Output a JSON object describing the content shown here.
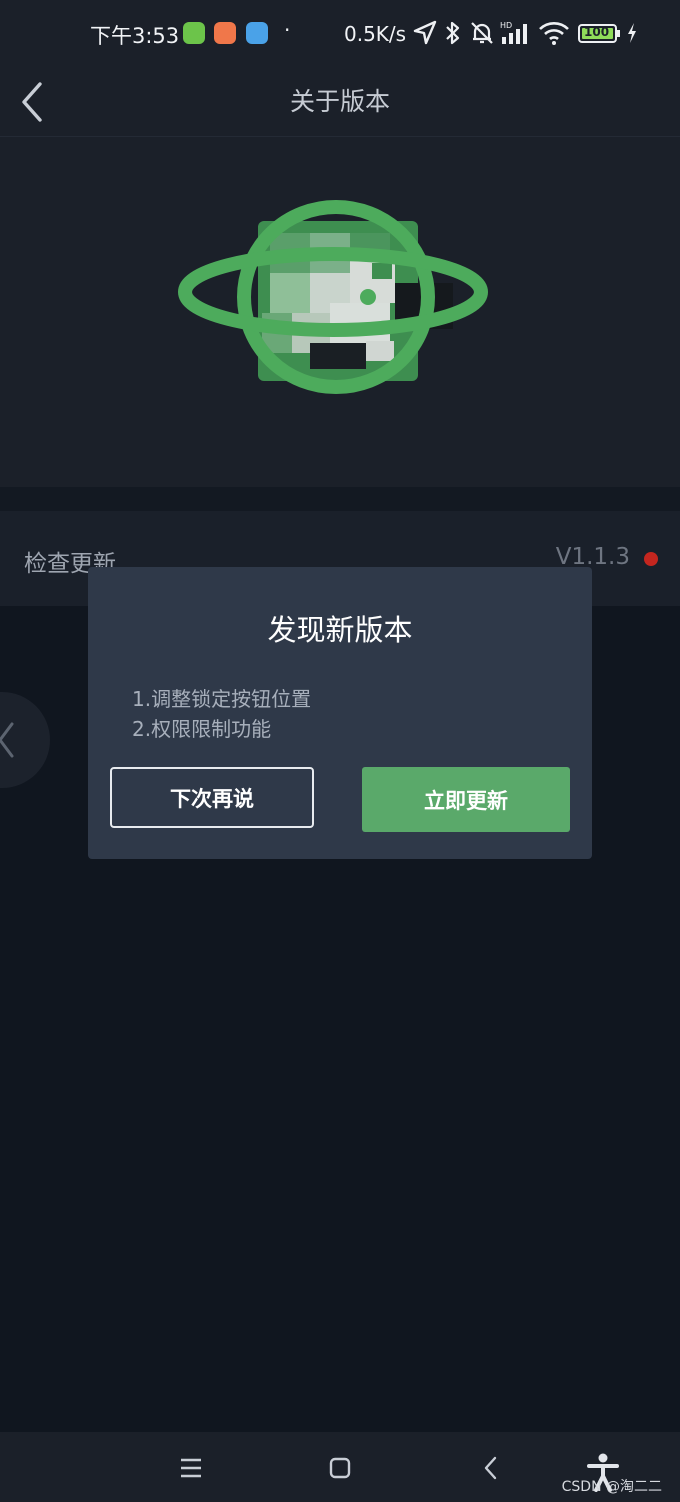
{
  "status_bar": {
    "time": "下午3:53",
    "dot": "·",
    "net_speed": "0.5K/s",
    "battery": "100",
    "icons": [
      "app-icon-green",
      "app-icon-orange",
      "app-icon-weather",
      "location-icon",
      "bluetooth-icon",
      "mute-icon",
      "signal-icon",
      "wifi-icon",
      "battery-icon",
      "charging-icon"
    ]
  },
  "nav": {
    "title": "关于版本",
    "back_icon": "chevron-left-icon"
  },
  "settings": {
    "check_update_label": "检查更新",
    "version": "V1.1.3"
  },
  "dialog": {
    "title": "发现新版本",
    "notes": [
      "1.调整锁定按钮位置",
      "2.权限限制功能"
    ],
    "later_label": "下次再说",
    "update_label": "立即更新"
  },
  "system_nav": {
    "icons": [
      "menu-icon",
      "home-icon",
      "back-icon",
      "accessibility-icon"
    ]
  },
  "watermark": "CSDN @淘二二",
  "colors": {
    "accent_green": "#5aa96a",
    "dialog_bg": "#2f3949",
    "badge_red": "#c4261f"
  }
}
